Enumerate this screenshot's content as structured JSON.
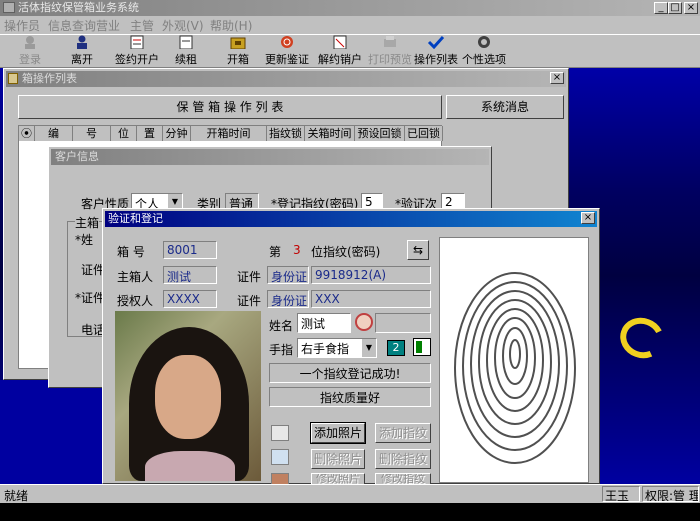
{
  "app_title": "活体指纹保管箱业务系统",
  "menu": [
    "操作员",
    "信息查询",
    "营业",
    "主管",
    "外观(V)",
    "帮助(H)"
  ],
  "toolbar": [
    {
      "label": "登录",
      "icon": "login-icon",
      "disabled": true
    },
    {
      "label": "离开",
      "icon": "user-leave-icon",
      "disabled": false
    },
    {
      "label": "签约开户",
      "icon": "contract-icon",
      "disabled": false
    },
    {
      "label": "续租",
      "icon": "renew-icon",
      "disabled": false
    },
    {
      "label": "开箱",
      "icon": "open-box-icon",
      "disabled": false
    },
    {
      "label": "更新鉴证",
      "icon": "fingerprint-update-icon",
      "disabled": false
    },
    {
      "label": "解约销户",
      "icon": "cancel-contract-icon",
      "disabled": false
    },
    {
      "label": "打印预览",
      "icon": "print-preview-icon",
      "disabled": true
    },
    {
      "label": "操作列表",
      "icon": "checkmark-icon",
      "disabled": false
    },
    {
      "label": "个性选项",
      "icon": "options-icon",
      "disabled": false
    }
  ],
  "op_list_window": {
    "title": "箱操作列表",
    "header_title": "保 管 箱 操 作 列 表",
    "system_msg": "系统消息",
    "columns": [
      "⦿",
      "编",
      "号",
      "位",
      "置",
      "分钟",
      "开箱时间",
      "指纹锁",
      "关箱时间",
      "预设回锁",
      "已回锁"
    ]
  },
  "customer_window": {
    "title": "客户信息",
    "customer_type_label": "客户性质",
    "customer_type_value": "个人",
    "category_label": "类别",
    "category_value": "普通",
    "reg_fp_label": "*登记指纹(密码)",
    "reg_fp_value": "5",
    "verify_label": "*验证次",
    "verify_value": "2",
    "group_label": "主箱",
    "name_label": "*姓",
    "id_label": "证件",
    "id2_label": "*证件",
    "phone_label": "电话"
  },
  "verify_window": {
    "title": "验证和登记",
    "box_no_label": "箱 号",
    "box_no": "8001",
    "owner_label": "主箱人",
    "owner": "测试",
    "auth_label": "授权人",
    "auth": "XXXX",
    "nth_prefix": "第",
    "nth_value": "3",
    "nth_suffix": "位指纹(密码)",
    "id_label": "证件",
    "id_type": "身份证",
    "id_value": "9918912(A)",
    "id2_label": "证件",
    "id2_type": "身份证",
    "id2_value": "XXX",
    "name_label": "姓名",
    "name_value": "测试",
    "finger_label": "手指",
    "finger_value": "右手食指",
    "finger_count": "2",
    "status_msg": "一个指纹登记成功!",
    "quality_msg": "指纹质量好",
    "buttons": {
      "add_photo": "添加照片",
      "add_fp": "添加指纹",
      "del_photo": "删除照片",
      "del_fp": "删除指纹",
      "edit_photo": "修改照片",
      "edit_fp": "修改指纹"
    }
  },
  "statusbar": {
    "status": "就绪",
    "user": "王玉明",
    "permission": "权限:管 理"
  }
}
